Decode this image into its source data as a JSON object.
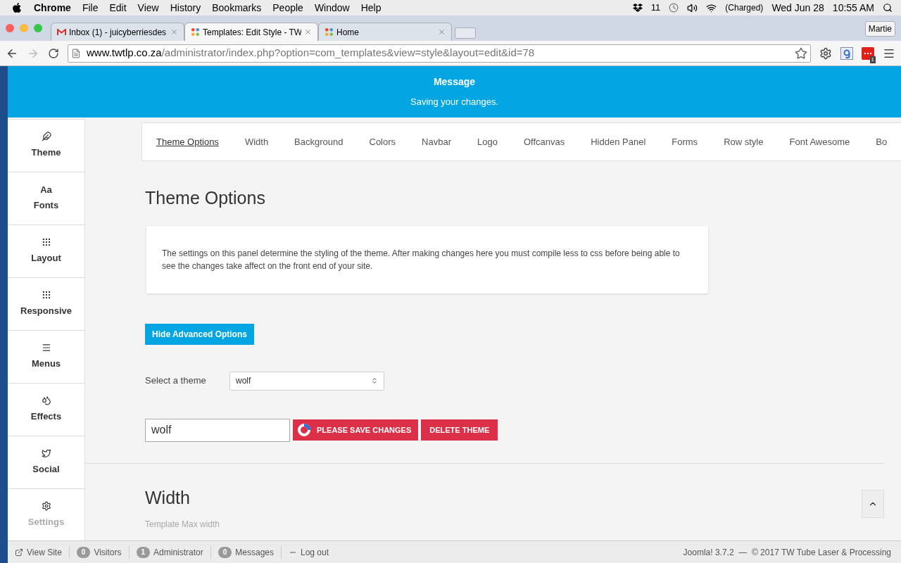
{
  "menubar": {
    "app": "Chrome",
    "menus": [
      "File",
      "Edit",
      "View",
      "History",
      "Bookmarks",
      "People",
      "Window",
      "Help"
    ],
    "status": {
      "adobe_count": "11",
      "battery": "(Charged)",
      "date": "Wed Jun 28",
      "time": "10:55 AM"
    }
  },
  "browser": {
    "tabs": [
      {
        "title": "Inbox (1) - juicyberriesdes",
        "kind": "mail",
        "selected": false
      },
      {
        "title": "Templates: Edit Style - TW",
        "kind": "joomla",
        "selected": true
      },
      {
        "title": "Home",
        "kind": "joomla",
        "selected": false
      }
    ],
    "profile": "Martie",
    "url_host": "www.twtlp.co.za",
    "url_path": "/administrator/index.php?option=com_templates&view=style&layout=edit&id=78",
    "extension_badge": "1"
  },
  "message": {
    "title": "Message",
    "text": "Saving your changes."
  },
  "sidebar": {
    "items": [
      {
        "label": "Theme",
        "kind": "feather"
      },
      {
        "label": "Fonts",
        "kind": "text",
        "glyph": "Aa"
      },
      {
        "label": "Layout",
        "kind": "grid"
      },
      {
        "label": "Responsive",
        "kind": "grid"
      },
      {
        "label": "Menus",
        "kind": "menu"
      },
      {
        "label": "Effects",
        "kind": "drops"
      },
      {
        "label": "Social",
        "kind": "bird"
      },
      {
        "label": "Settings",
        "kind": "gear",
        "faded": true
      }
    ]
  },
  "subtabs": [
    {
      "label": "Theme Options",
      "selected": true
    },
    {
      "label": "Width",
      "selected": false
    },
    {
      "label": "Background",
      "selected": false
    },
    {
      "label": "Colors",
      "selected": false
    },
    {
      "label": "Navbar",
      "selected": false
    },
    {
      "label": "Logo",
      "selected": false
    },
    {
      "label": "Offcanvas",
      "selected": false
    },
    {
      "label": "Hidden Panel",
      "selected": false
    },
    {
      "label": "Forms",
      "selected": false
    },
    {
      "label": "Row style",
      "selected": false
    },
    {
      "label": "Font Awesome",
      "selected": false
    },
    {
      "label": "Bo",
      "selected": false
    }
  ],
  "theme_options": {
    "heading": "Theme Options",
    "description": "The settings on this panel determine the styling of the theme. After making changes here you must compile less to css before being able to see the changes take affect on the front end of your site.",
    "advanced_button": "Hide Advanced Options",
    "select_label": "Select a theme",
    "select_value": "wolf",
    "name_value": "wolf",
    "save_button": "PLEASE SAVE CHANGES",
    "delete_button": "DELETE THEME"
  },
  "width": {
    "heading": "Width",
    "field_label": "Template Max width"
  },
  "status_bar": {
    "left": [
      {
        "label": "View Site",
        "kind": "link"
      },
      {
        "count": "0",
        "label": "Visitors",
        "kind": "count"
      },
      {
        "count": "1",
        "label": "Administrator",
        "kind": "count"
      },
      {
        "count": "0",
        "label": "Messages",
        "kind": "count"
      },
      {
        "label": "Log out",
        "kind": "logout"
      }
    ],
    "right": "Joomla! 3.7.2  —  © 2017 TW Tube Laser & Processing"
  }
}
